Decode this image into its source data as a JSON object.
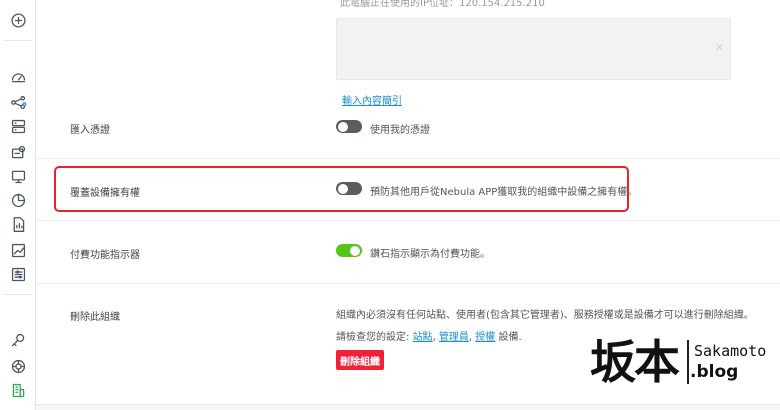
{
  "sidebar": {
    "icons": [
      "add-circle-icon",
      "dashboard-gauge-icon",
      "network-topology-icon",
      "server-stack-icon",
      "device-gear-icon",
      "monitor-icon",
      "pie-chart-icon",
      "report-document-icon",
      "line-chart-icon",
      "settings-sliders-icon",
      "key-search-icon",
      "support-compass-icon",
      "building-icon"
    ]
  },
  "content": {
    "top_note": "此電腦正在使用的IP位址：120.154.215.210",
    "insert_link": "輸入內容簡引",
    "rows": {
      "import_cert": {
        "label": "匯入憑證",
        "toggle_text": "使用我的憑證",
        "enabled": false
      },
      "override_ownership": {
        "label": "覆蓋設備擁有權",
        "toggle_text": "預防其他用戶從Nebula APP獲取我的組織中設備之擁有權。",
        "enabled": false
      },
      "paid_indicator": {
        "label": "付費功能指示器",
        "toggle_text": "鑽石指示顯示為付費功能。",
        "enabled": true
      },
      "delete_org": {
        "label": "刪除此組織",
        "desc": "組織內必須沒有任何站點、使用者(包含其它管理者)、服務授權或是設備才可以進行刪除組織。",
        "check_prefix": "請檢查您的設定:",
        "link_sites": "站點",
        "link_admins": "管理員",
        "link_license": "授權",
        "check_suffix": "設備.",
        "button": "刪除組織"
      }
    }
  },
  "watermark": {
    "cn": "坂本",
    "en1": "Sakamoto",
    "en2": ".blog"
  },
  "colors": {
    "accent_blue": "#1a90d6",
    "danger_red": "#f1213a",
    "toggle_on": "#52c41a",
    "highlight_red": "#e0262b"
  }
}
